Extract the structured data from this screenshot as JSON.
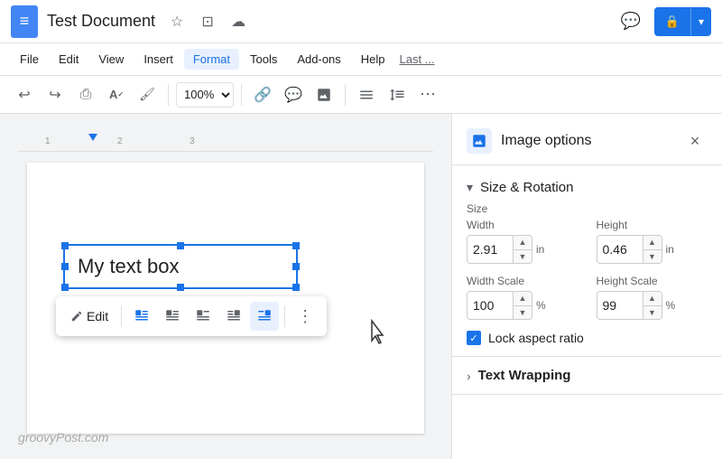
{
  "app": {
    "icon": "≡",
    "title": "Test Document",
    "star_icon": "☆",
    "drive_icon": "⊡",
    "cloud_icon": "☁"
  },
  "menu": {
    "items": [
      "File",
      "Edit",
      "View",
      "Insert",
      "Format",
      "Tools",
      "Add-ons",
      "Help"
    ],
    "active": "Format",
    "last_edit": "Last ..."
  },
  "toolbar": {
    "undo_label": "↩",
    "redo_label": "↪",
    "print_label": "⎙",
    "spell_label": "A",
    "paint_label": "🖌",
    "zoom_value": "100%",
    "link_label": "🔗",
    "comment_label": "💬",
    "image_label": "🖼",
    "align_label": "≡",
    "spacing_label": "↕",
    "more_label": "⋯"
  },
  "document": {
    "text_box_content": "My text box"
  },
  "float_toolbar": {
    "edit_label": "Edit",
    "align_buttons": [
      {
        "id": "inline",
        "title": "Inline"
      },
      {
        "id": "wrap-left",
        "title": "Wrap text left"
      },
      {
        "id": "break-left",
        "title": "Break text left"
      },
      {
        "id": "wrap-right",
        "title": "Wrap text right"
      },
      {
        "id": "break-right",
        "title": "Break text right - active"
      }
    ],
    "more_label": "⋮"
  },
  "panel": {
    "title": "Image options",
    "close_label": "×",
    "size_rotation": {
      "section_title": "Size & Rotation",
      "size_label": "Size",
      "width_label": "Width",
      "width_value": "2.91",
      "width_unit": "in",
      "height_label": "Height",
      "height_value": "0.46",
      "height_unit": "in",
      "width_scale_label": "Width Scale",
      "width_scale_value": "100",
      "width_scale_unit": "%",
      "height_scale_label": "Height Scale",
      "height_scale_value": "99",
      "height_scale_unit": "%",
      "lock_label": "Lock aspect ratio",
      "lock_checked": true
    },
    "text_wrapping": {
      "section_title": "Text Wrapping"
    }
  },
  "watermark": {
    "text": "groovyPost.com"
  }
}
